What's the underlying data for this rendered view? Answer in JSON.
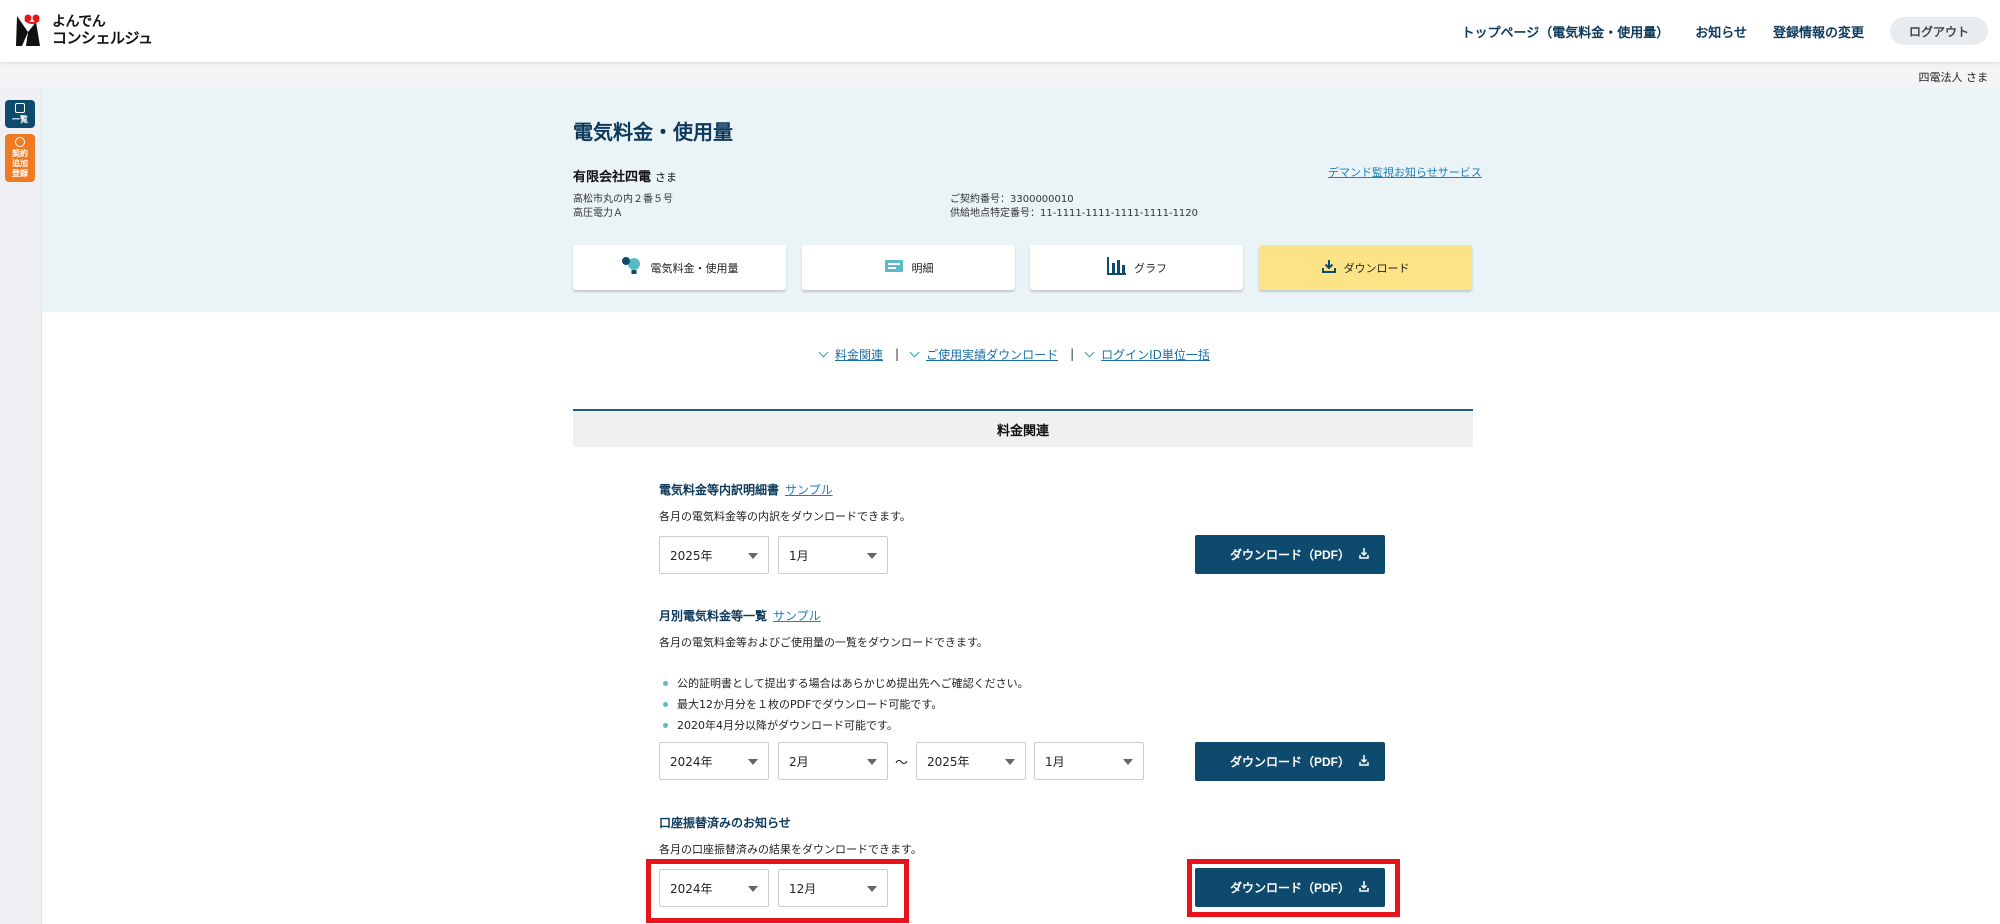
{
  "header": {
    "logo_line1": "よんでん",
    "logo_line2": "コンシェルジュ",
    "nav": [
      "トップページ（電気料金・使用量）",
      "お知らせ",
      "登録情報の変更"
    ],
    "logout": "ログアウト",
    "user": "四電法人 さま"
  },
  "sidebar": {
    "list_label": "一覧",
    "contract_add_label_1": "契約",
    "contract_add_label_2": "追加",
    "contract_add_label_3": "登録"
  },
  "info": {
    "title": "電気料金・使用量",
    "customer": "有限会社四電",
    "honorific": "さま",
    "demand_link": "デマンド監視お知らせサービス",
    "address": "高松市丸の内２番５号",
    "plan": "高圧電力Ａ",
    "contract_no": "ご契約番号：3300000010",
    "supply_point": "供給地点特定番号：11-1111-1111-1111-1111-1120"
  },
  "tabs": [
    "電気料金・使用量",
    "明細",
    "グラフ",
    "ダウンロード"
  ],
  "anchors": [
    "料金関連",
    "ご使用実績ダウンロード",
    "ログインID単位一括"
  ],
  "section": {
    "title": "料金関連"
  },
  "items": [
    {
      "title": "電気料金等内訳明細書",
      "sample": "サンプル",
      "desc": "各月の電気料金等の内訳をダウンロードできます。",
      "year": "2025年",
      "month": "1月",
      "button": "ダウンロード（PDF）"
    },
    {
      "title": "月別電気料金等一覧",
      "sample": "サンプル",
      "desc": "各月の電気料金等およびご使用量の一覧をダウンロードできます。",
      "bullets": [
        "公的証明書として提出する場合はあらかじめ提出先へご確認ください。",
        "最大12か月分を１枚のPDFでダウンロード可能です。",
        "2020年4月分以降がダウンロード可能です。"
      ],
      "from_year": "2024年",
      "from_month": "2月",
      "tilde": "〜",
      "to_year": "2025年",
      "to_month": "1月",
      "button": "ダウンロード（PDF）"
    },
    {
      "title": "口座振替済みのお知らせ",
      "desc": "各月の口座振替済みの結果をダウンロードできます。",
      "year": "2024年",
      "month": "12月",
      "button": "ダウンロード（PDF）"
    }
  ],
  "colors": {
    "navy": "#0e4a6e",
    "accent_yellow": "#fbe386",
    "band": "#eaf4f7",
    "highlight": "#e8141c",
    "orange": "#f07a22"
  }
}
